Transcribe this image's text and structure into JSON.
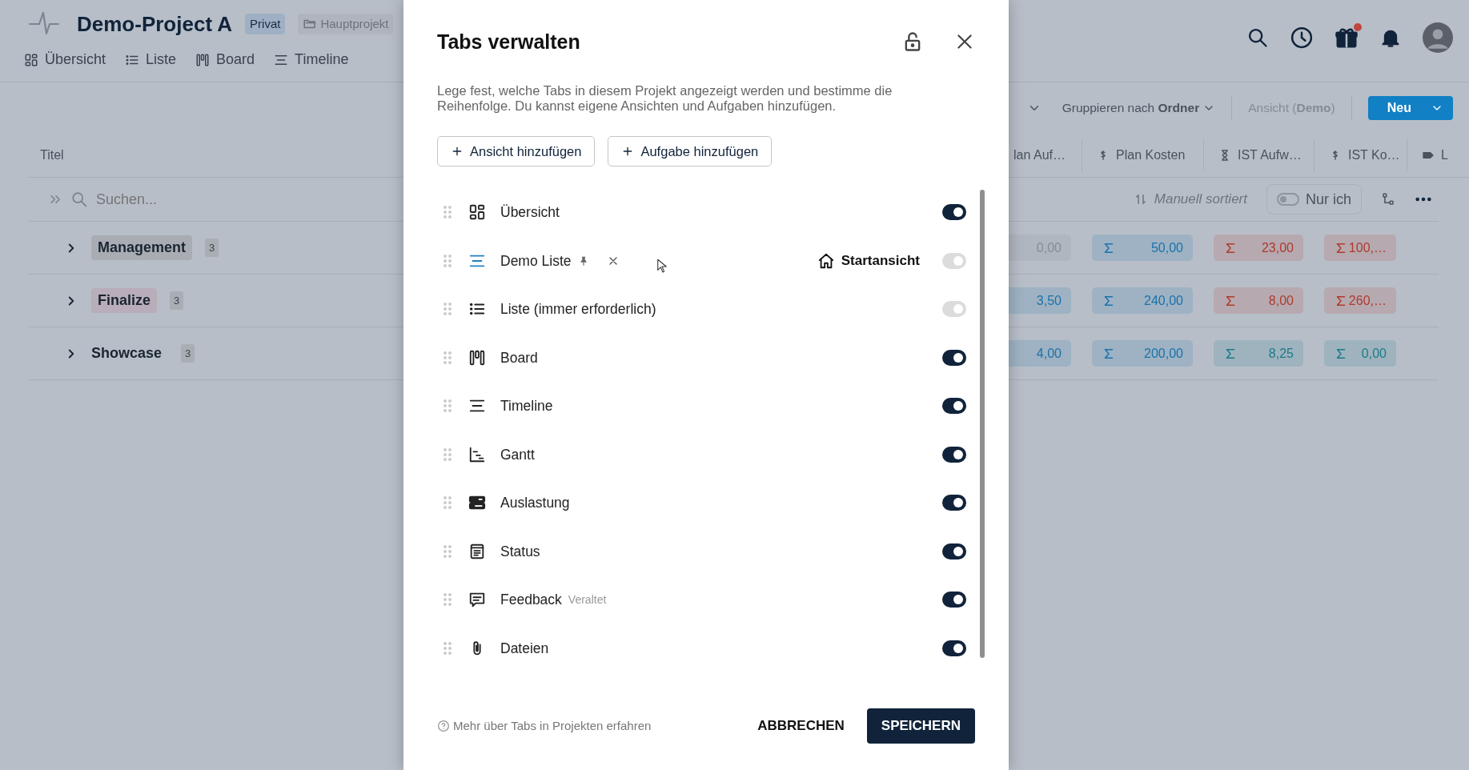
{
  "header": {
    "title": "Demo-Project A",
    "visibility": "Privat",
    "parent": "Hauptprojekt",
    "gift_badge": true,
    "tabs": [
      {
        "label": "Übersicht",
        "kind": "overview"
      },
      {
        "label": "Liste",
        "kind": "list"
      },
      {
        "label": "Board",
        "kind": "board"
      },
      {
        "label": "Timeline",
        "kind": "timeline"
      }
    ]
  },
  "toolbar": {
    "group_by": "Gruppieren nach **Ordner**",
    "view": "Ansicht (**Demo**)",
    "new_button": "Neu"
  },
  "table": {
    "title_column": "Titel",
    "columns": [
      {
        "label": "lan Auf…",
        "kind": "plain"
      },
      {
        "label": "Plan Kosten",
        "kind": "money"
      },
      {
        "label": "IST Aufw…",
        "kind": "hourglass"
      },
      {
        "label": "IST Ko…",
        "kind": "money"
      },
      {
        "label": "L",
        "kind": "tag"
      }
    ],
    "search_placeholder": "Suchen...",
    "sort_label": "Manuell sortiert",
    "only_me": {
      "label": "Nur ich",
      "on": false
    },
    "groups": [
      {
        "name": "Management",
        "count": "3",
        "color": "#a9adb3",
        "cells": [
          {
            "value": "0,00",
            "color": "#868c94"
          },
          {
            "value": "50,00",
            "color": "#1a72ab",
            "sum": true
          },
          {
            "value": "23,00",
            "color": "#b03a2e",
            "sum": true
          },
          {
            "value": "100,…",
            "color": "#b03a2e",
            "sum": true
          }
        ]
      },
      {
        "name": "Finalize",
        "count": "3",
        "color": "#b8adb8",
        "cells": [
          {
            "value": "3,50",
            "color": "#1a72ab"
          },
          {
            "value": "240,00",
            "color": "#1a72ab",
            "sum": true
          },
          {
            "value": "8,00",
            "color": "#b03a2e",
            "sum": true
          },
          {
            "value": "260,…",
            "color": "#b03a2e",
            "sum": true
          }
        ]
      },
      {
        "name": "Showcase",
        "count": "3",
        "cells": [
          {
            "value": "4,00",
            "color": "#1a72ab"
          },
          {
            "value": "200,00",
            "color": "#1a72ab",
            "sum": true
          },
          {
            "value": "8,25",
            "color": "#1d7a8a",
            "sum": true
          },
          {
            "value": "0,00",
            "color": "#1d7a8a",
            "sum": true
          }
        ]
      }
    ]
  },
  "modal": {
    "title": "Tabs verwalten",
    "locked": false,
    "description": "Lege fest, welche Tabs in diesem Projekt angezeigt werden und bestimme die Reihenfolge. Du kannst eigene Ansichten und Aufgaben hinzufügen.",
    "add_buttons": [
      "Ansicht hinzufügen",
      "Aufgabe hinzufügen"
    ],
    "items": [
      {
        "label": "Übersicht",
        "kind": "overview",
        "on": true,
        "disabled": false,
        "pinned": false,
        "removable": false
      },
      {
        "label": "Demo Liste",
        "kind": "custom",
        "on": true,
        "disabled": true,
        "pinned": true,
        "removable": true,
        "start_label": "Startansicht"
      },
      {
        "label": "Liste (immer erforderlich)",
        "kind": "list",
        "on": true,
        "disabled": true,
        "pinned": false,
        "removable": false
      },
      {
        "label": "Board",
        "kind": "board",
        "on": true,
        "disabled": false,
        "pinned": false,
        "removable": false
      },
      {
        "label": "Timeline",
        "kind": "timeline",
        "on": true,
        "disabled": false,
        "pinned": false,
        "removable": false
      },
      {
        "label": "Gantt",
        "kind": "gantt",
        "on": true,
        "disabled": false,
        "pinned": false,
        "removable": false
      },
      {
        "label": "Auslastung",
        "kind": "workload",
        "on": true,
        "disabled": false,
        "pinned": false,
        "removable": false
      },
      {
        "label": "Status",
        "kind": "status",
        "on": true,
        "disabled": false,
        "pinned": false,
        "removable": false
      },
      {
        "label": "Feedback",
        "kind": "feedback",
        "on": true,
        "disabled": false,
        "pinned": false,
        "removable": false,
        "note": "Veraltet"
      },
      {
        "label": "Dateien",
        "kind": "files",
        "on": true,
        "disabled": false,
        "pinned": false,
        "removable": false
      }
    ],
    "help_link": "Mehr über Tabs in Projekten erfahren",
    "cancel": "ABBRECHEN",
    "save": "SPEICHERN"
  }
}
